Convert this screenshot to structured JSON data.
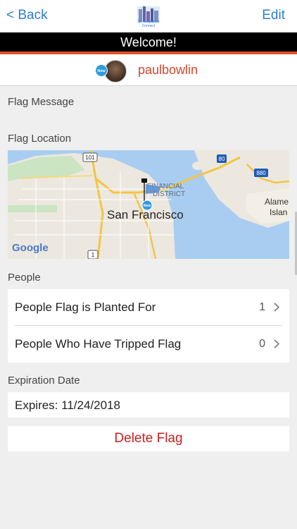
{
  "navbar": {
    "back_label": "< Back",
    "edit_label": "Edit",
    "logo_text_line1": "SF Neighbors",
    "logo_text_line2": "Connect"
  },
  "welcome": {
    "text": "Welcome!"
  },
  "user": {
    "badge": "New",
    "username": "paulbowlin"
  },
  "sections": {
    "flag_message": "Flag Message",
    "flag_location": "Flag Location",
    "people": "People",
    "expiration_date": "Expiration Date"
  },
  "map": {
    "city_label": "San Francisco",
    "district_line1": "FINANCIAL",
    "district_line2": "DISTRICT",
    "alameda_line1": "Alame",
    "alameda_line2": "Islan",
    "route_101": "101",
    "route_80": "80",
    "route_880": "880",
    "route_1": "1",
    "google_logo": "Google",
    "pin_badge": "New"
  },
  "people": {
    "rows": [
      {
        "label": "People Flag is Planted For",
        "count": "1"
      },
      {
        "label": "People Who Have Tripped Flag",
        "count": "0"
      }
    ]
  },
  "expiration": {
    "text": "Expires: 11/24/2018"
  },
  "actions": {
    "delete_label": "Delete Flag"
  },
  "colors": {
    "accent_blue": "#2d7fd3",
    "welcome_bg": "#000000",
    "welcome_underline": "#e0502a",
    "username": "#d6452a",
    "delete": "#cc1f1f"
  }
}
